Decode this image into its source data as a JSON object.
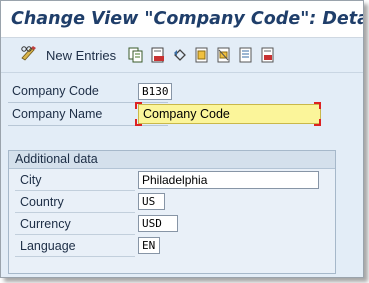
{
  "window": {
    "title": "Change View \"Company Code\": Details"
  },
  "toolbar": {
    "new_entries_label": "New Entries",
    "icons": [
      "copy-icon",
      "delete-icon",
      "undo-icon",
      "select-all-icon",
      "deselect-icon",
      "details-icon",
      "print-icon"
    ]
  },
  "fields": {
    "company_code": {
      "label": "Company Code",
      "value": "B130"
    },
    "company_name": {
      "label": "Company Name",
      "value": "Company Code"
    }
  },
  "additional_data": {
    "title": "Additional data",
    "city": {
      "label": "City",
      "value": "Philadelphia"
    },
    "country": {
      "label": "Country",
      "value": "US"
    },
    "currency": {
      "label": "Currency",
      "value": "USD"
    },
    "language": {
      "label": "Language",
      "value": "EN"
    }
  },
  "colors": {
    "title": "#1f3e6a",
    "background": "#e3edf7",
    "highlight_field": "#fbf59a",
    "focus_corner": "#dd2222"
  }
}
